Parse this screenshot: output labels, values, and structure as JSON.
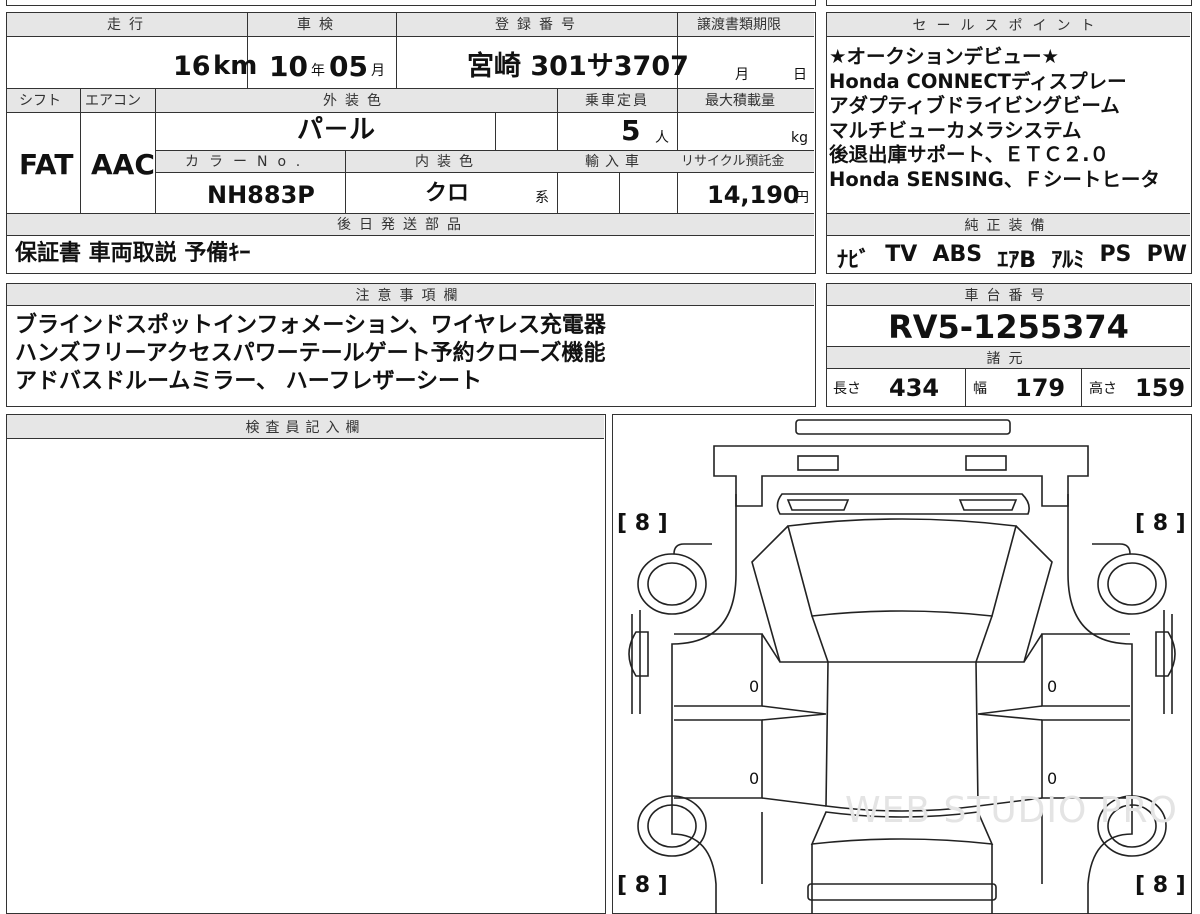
{
  "top": {
    "mileage": {
      "label": "走行",
      "value": "16",
      "unit": "km"
    },
    "inspection": {
      "label": "車検",
      "year": "10",
      "year_unit": "年",
      "month": "05",
      "month_unit": "月"
    },
    "registration": {
      "label": "登録番号",
      "value": "宮崎 301サ3707"
    },
    "transfer": {
      "label": "譲渡書類期限",
      "month_unit": "月",
      "day_unit": "日"
    },
    "shift": {
      "label": "シフト",
      "value": "FAT"
    },
    "aircon": {
      "label": "エアコン",
      "value": "AAC"
    },
    "exterior_color": {
      "label": "外装色",
      "value": "パ－ル"
    },
    "capacity": {
      "label": "乗車定員",
      "value": "5",
      "unit": "人"
    },
    "max_load": {
      "label": "最大積載量",
      "unit": "kg"
    },
    "color_no": {
      "label": "カラーNo.",
      "value": "NH883P"
    },
    "interior": {
      "label": "内装色",
      "value": "クロ",
      "unit": "系"
    },
    "import": {
      "label": "輸入車"
    },
    "recycle": {
      "label": "リサイクル預託金",
      "value": "14,190",
      "unit": "円"
    },
    "later_parts": {
      "label": "後日発送部品",
      "value": "保証書 車両取説 予備ｷｰ"
    }
  },
  "sales": {
    "label": "セールスポイント",
    "lines": [
      "★オークションデビュー★",
      "Honda CONNECTディスプレー",
      "アダプティブドライビングビーム",
      "マルチビューカメラシステム",
      "後退出庫サポート、ＥＴＣ２.０",
      "Honda SENSING、Ｆシートヒータ"
    ]
  },
  "equipment": {
    "label": "純正装備",
    "items": [
      "ﾅﾋﾞ",
      "TV",
      "ABS",
      "ｴｱB",
      "ｱﾙﾐ",
      "PS",
      "PW"
    ]
  },
  "notes": {
    "label": "注意事項欄",
    "lines": [
      "ブラインドスポットインフォメーション、ワイヤレス充電器",
      "ハンズフリーアクセスパワーテールゲート予約クローズ機能",
      "アドバスドルームミラー、 ハーフレザーシート"
    ]
  },
  "chassis": {
    "label": "車台番号",
    "value": "RV5-1255374"
  },
  "specs": {
    "label": "諸元",
    "length": {
      "label": "長さ",
      "value": "434"
    },
    "width": {
      "label": "幅",
      "value": "179"
    },
    "height": {
      "label": "高さ",
      "value": "159"
    }
  },
  "inspector": {
    "label": "検査員記入欄"
  },
  "diagram": {
    "tire_front_left": "[ 8 ]",
    "tire_front_right": "[ 8 ]",
    "tire_rear_left": "[ 8 ]",
    "tire_rear_right": "[ 8 ]",
    "door_marks": [
      "0",
      "0",
      "0",
      "0"
    ],
    "watermark": "WEB STUDIO PRO"
  }
}
